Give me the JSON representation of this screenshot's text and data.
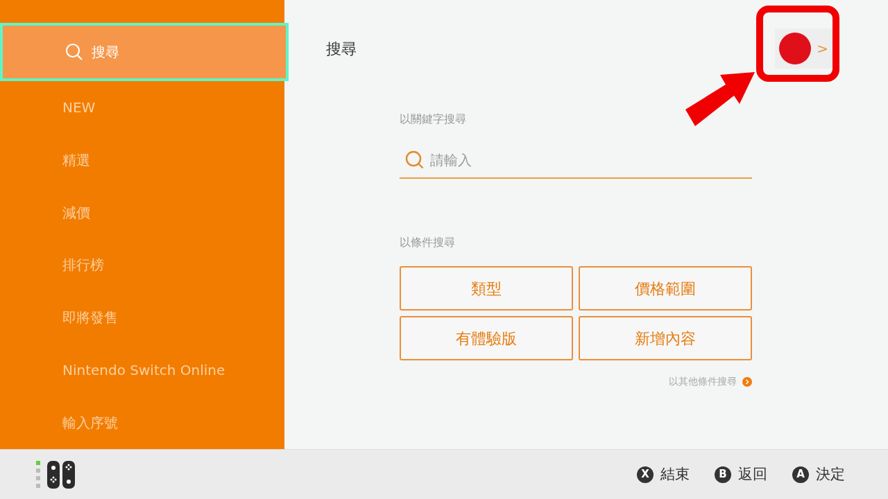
{
  "sidebar": {
    "items": [
      {
        "label": "搜尋",
        "kind": "search",
        "selected": true
      },
      {
        "label": "NEW",
        "selected": false
      },
      {
        "label": "精選",
        "selected": false
      },
      {
        "label": "減價",
        "selected": false
      },
      {
        "label": "排行榜",
        "selected": false
      },
      {
        "label": "即將發售",
        "selected": false
      },
      {
        "label": "Nintendo Switch Online",
        "selected": false
      },
      {
        "label": "輸入序號",
        "selected": false
      }
    ]
  },
  "header": {
    "title": "搜尋",
    "account_chevron": ">"
  },
  "keyword_search": {
    "label": "以關鍵字搜尋",
    "placeholder": "請輸入"
  },
  "condition_search": {
    "label": "以條件搜尋",
    "buttons": [
      "類型",
      "價格範圍",
      "有體驗版",
      "新增內容"
    ],
    "more_link": "以其他條件搜尋"
  },
  "footer": {
    "actions": [
      {
        "key": "X",
        "label": "結束"
      },
      {
        "key": "B",
        "label": "返回"
      },
      {
        "key": "A",
        "label": "決定"
      }
    ]
  }
}
